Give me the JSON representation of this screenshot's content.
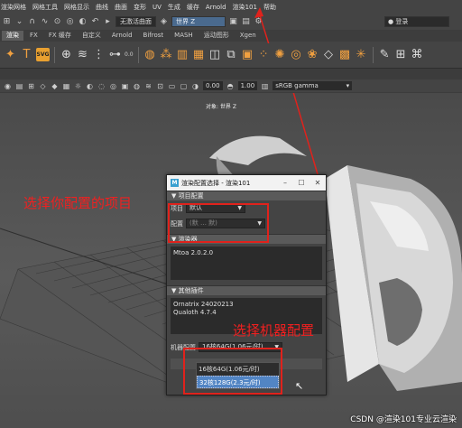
{
  "menu": [
    "渲染网格",
    "网格工具",
    "网格显示",
    "曲线",
    "曲面",
    "变形",
    "UV",
    "生成",
    "缓存",
    "Arnold",
    "渲染101",
    "帮助"
  ],
  "status_line": {
    "no_live_surface": "无激活曲面",
    "workspace": "世界 Z",
    "login": "登录"
  },
  "shelf_tabs": [
    "渲染",
    "FX",
    "FX 缓存",
    "自定义",
    "Arnold",
    "Bifrost",
    "MASH",
    "运动图形",
    "Xgen"
  ],
  "shelf": {
    "svg_label": "SVG",
    "value": "0.0"
  },
  "viewport_toolbar": {
    "value1": "0.00",
    "value2": "1.00",
    "color_space": "sRGB gamma"
  },
  "viewport": {
    "camera_label": "对象: 世界 Z"
  },
  "dialog": {
    "logo": "M",
    "title": "渲染配置选择 - 渲染101",
    "section_project": "项目配置",
    "project_label": "项目",
    "project_value": "默认",
    "config_label": "配置",
    "config_value": "(默 … 默)",
    "section_renderer": "渲染器",
    "renderer_text": "Mtoa 2.0.2.0",
    "section_plugins": "其他插件",
    "plugins": [
      "Ornatrix 24020213",
      "Qualoth 4.7.4"
    ],
    "machine_label": "机器配置",
    "machine_value": "16核64G(1.06元/时)",
    "machine_options": [
      "16核64G(1.06元/时)",
      "32核128G(2.3元/时)"
    ],
    "selected_option": 1
  },
  "annotations": {
    "select_project": "选择你配置的项目",
    "select_machine": "选择机器配置"
  },
  "watermark": "CSDN @渲染101专业云渲染",
  "colors": {
    "annotation": "#e0221c",
    "highlight": "#5285c4",
    "workspace_field": "#4a6a8e"
  }
}
